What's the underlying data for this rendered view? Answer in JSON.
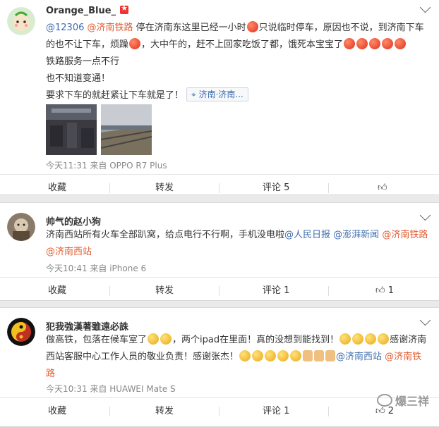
{
  "posts": [
    {
      "username": "Orange_Blue_",
      "text": {
        "at1": "@12306",
        "hash1": "@济南铁路",
        "p1": "停在济南东这里已经一小时",
        "p2": "只说临时停车，原因也不说，到济南下车的也不让下车，烦躁",
        "p3": "，大中午的，赶不上回家吃饭了都，饿死本宝宝了",
        "line2": "铁路服务一点不行",
        "line3": "也不知道变通！",
        "line4": "要求下车的就赶紧让下车就是了！",
        "location": "济南·济南..."
      },
      "time": "今天11:31 来自 OPPO R7 Plus",
      "actions": {
        "collect": "收藏",
        "forward": "转发",
        "comment": "评论 5",
        "like": ""
      }
    },
    {
      "username": "帅气的赵小狗",
      "text": {
        "p1": "济南西站所有火车全部趴窝，给点电行不行啊，手机没电啦",
        "at1": "@人民日报",
        "at2": "@澎湃新闻",
        "hash1": "@济南铁路",
        "hash2": "@济南西站"
      },
      "time": "今天10:41 来自 iPhone 6",
      "actions": {
        "collect": "收藏",
        "forward": "转发",
        "comment": "评论 1",
        "like": "1"
      }
    },
    {
      "username": "犯我強漢著雖遠必誅",
      "text": {
        "p1": "做高铁，包落在候车室了",
        "p2": "，两个ipad在里面！真的没想到能找到！",
        "p3": "感谢济南西站客服中心工作人员的敬业负责！感谢张杰！",
        "at1": "@济南西站",
        "hash1": "@济南铁路"
      },
      "time": "今天10:31 来自 HUAWEI Mate S",
      "actions": {
        "collect": "收藏",
        "forward": "转发",
        "comment": "评论 1",
        "like": "2"
      }
    }
  ],
  "watermark": "爆三祥",
  "colors": {
    "link": "#3c6cae",
    "hashtag": "#e35a2e"
  }
}
